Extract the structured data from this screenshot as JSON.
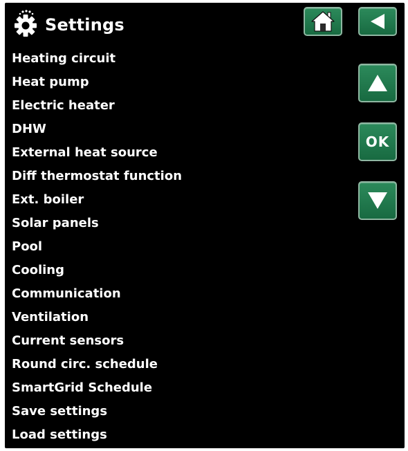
{
  "header": {
    "title": "Settings",
    "icon": "gear-icon"
  },
  "menu": {
    "items": [
      {
        "label": "Heating circuit"
      },
      {
        "label": "Heat pump"
      },
      {
        "label": "Electric heater"
      },
      {
        "label": "DHW"
      },
      {
        "label": "External heat source"
      },
      {
        "label": "Diff thermostat function"
      },
      {
        "label": "Ext. boiler"
      },
      {
        "label": "Solar panels"
      },
      {
        "label": "Pool"
      },
      {
        "label": "Cooling"
      },
      {
        "label": "Communication"
      },
      {
        "label": "Ventilation"
      },
      {
        "label": "Current sensors"
      },
      {
        "label": "Round circ. schedule"
      },
      {
        "label": "SmartGrid Schedule"
      },
      {
        "label": "Save settings"
      },
      {
        "label": "Load settings"
      }
    ]
  },
  "buttons": {
    "home": {
      "icon": "home-icon"
    },
    "back": {
      "icon": "back-arrow-icon"
    },
    "up": {
      "icon": "arrow-up-icon"
    },
    "ok": {
      "label": "OK"
    },
    "down": {
      "icon": "arrow-down-icon"
    }
  },
  "colors": {
    "background": "#000000",
    "text": "#ffffff",
    "button_green": "#237a4e",
    "button_border": "#8fb7a2"
  }
}
